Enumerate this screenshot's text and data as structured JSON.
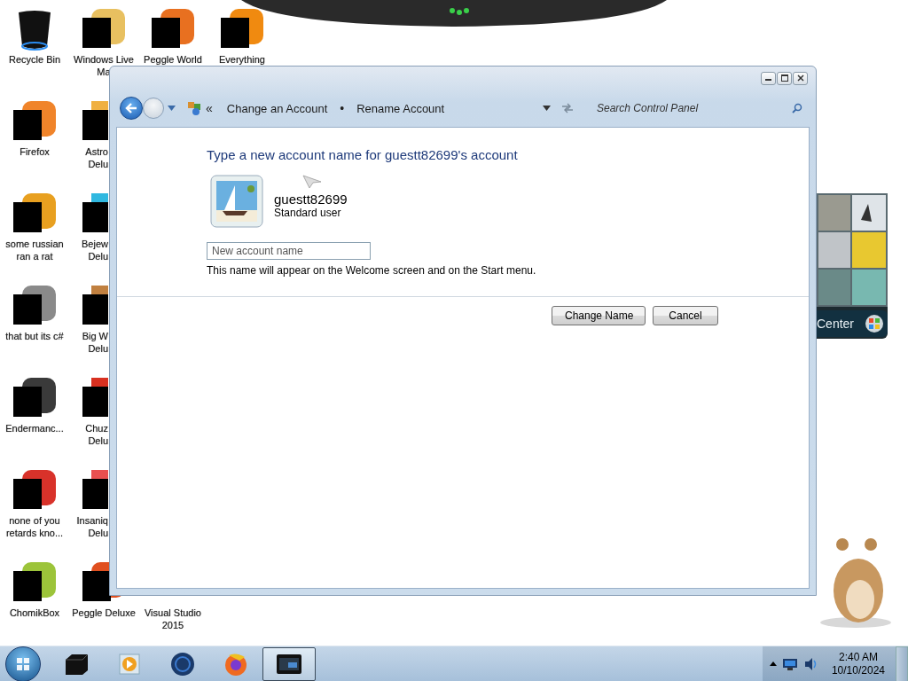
{
  "desktop_columns": [
    {
      "icons": [
        {
          "kind": "bin",
          "lines": [
            "Recycle Bin"
          ],
          "covered": false
        },
        {
          "kind": "app",
          "color": "#f0842a",
          "lines": [
            "Firefox"
          ],
          "covered": false
        },
        {
          "kind": "app",
          "color": "#e8a020",
          "lines": [
            "some russian",
            "ran a rat"
          ],
          "covered": false
        },
        {
          "kind": "app",
          "color": "#8a8a8a",
          "lines": [
            "that but its c#"
          ],
          "covered": false
        },
        {
          "kind": "app",
          "color": "#3a3a3a",
          "lines": [
            "Endermanc..."
          ],
          "covered": false
        },
        {
          "kind": "app",
          "color": "#d8322a",
          "lines": [
            "none of you",
            "retards kno..."
          ],
          "covered": false
        },
        {
          "kind": "app",
          "color": "#9cc43a",
          "lines": [
            "ChomikBox"
          ],
          "covered": false
        }
      ]
    },
    {
      "icons": [
        {
          "kind": "app",
          "color": "#e8c060",
          "lines": [
            "Windows Live",
            "Ma"
          ],
          "covered": false
        },
        {
          "kind": "app",
          "color": "#f0b040",
          "lines": [
            "Astro",
            "Delu"
          ],
          "covered": true
        },
        {
          "kind": "app",
          "color": "#30b8e0",
          "lines": [
            "Bejew",
            "Delu"
          ],
          "covered": true
        },
        {
          "kind": "app",
          "color": "#c08040",
          "lines": [
            "Big W",
            "Delu"
          ],
          "covered": true
        },
        {
          "kind": "app",
          "color": "#d83020",
          "lines": [
            "Chuz",
            "Delu"
          ],
          "covered": true
        },
        {
          "kind": "app",
          "color": "#e85050",
          "lines": [
            "Insaniq",
            "Delu"
          ],
          "covered": true
        },
        {
          "kind": "app",
          "color": "#e05020",
          "lines": [
            "Peggle Deluxe"
          ],
          "covered": false
        }
      ]
    },
    {
      "icons": [
        {
          "kind": "app",
          "color": "#e87020",
          "lines": [
            "Peggle World"
          ],
          "covered": false
        },
        {
          "kind": "hidden",
          "lines": [
            "Visual Studio",
            "2015"
          ],
          "covered": false
        }
      ]
    },
    {
      "icons": [
        {
          "kind": "app",
          "color": "#f08a10",
          "lines": [
            "Everything"
          ],
          "covered": false
        }
      ]
    }
  ],
  "window": {
    "breadcrumbs": [
      "Change an Account",
      "Rename Account"
    ],
    "breadcrumb_overflow": "«",
    "separator": "•",
    "search": {
      "placeholder": "Search Control Panel"
    },
    "heading": "Type a new account name for guestt82699's account",
    "account": {
      "name": "guestt82699",
      "type": "Standard user"
    },
    "field": {
      "placeholder": "New account name"
    },
    "hint": "This name will appear on the Welcome screen and on the Start menu.",
    "buttons": [
      "Change Name",
      "Cancel"
    ]
  },
  "media_center_gadget": {
    "label": "Center"
  },
  "taskbar": {
    "apps": [
      {
        "kind": "box",
        "selected": false
      },
      {
        "kind": "media",
        "selected": false
      },
      {
        "kind": "globe",
        "selected": false
      },
      {
        "kind": "firefox",
        "selected": false
      },
      {
        "kind": "screen",
        "selected": true
      }
    ],
    "clock": {
      "time": "2:40 AM",
      "date": "10/10/2024"
    }
  }
}
